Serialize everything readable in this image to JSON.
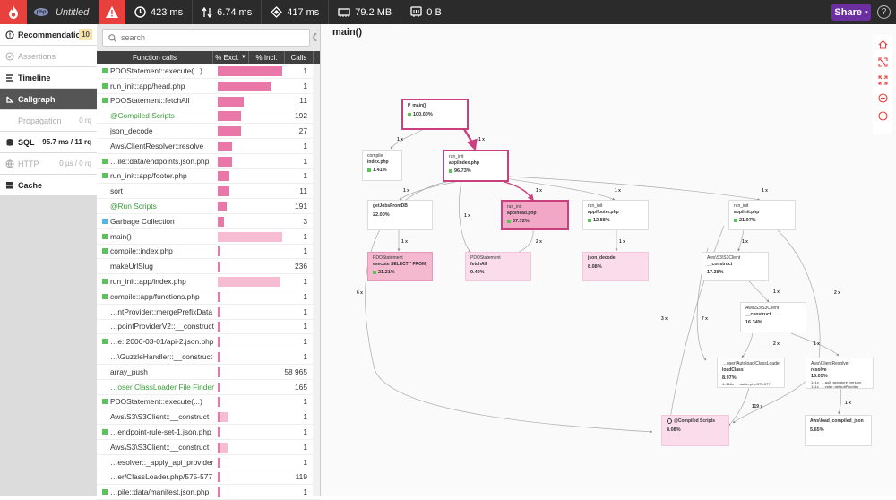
{
  "app": {
    "title": "Untitled",
    "php_badge": "php",
    "share": "Share",
    "help": "?"
  },
  "metrics": [
    {
      "icon": "clock-icon",
      "value": "423 ms"
    },
    {
      "icon": "io-wait-icon",
      "value": "6.74 ms"
    },
    {
      "icon": "cpu-icon",
      "value": "417 ms"
    },
    {
      "icon": "memory-icon",
      "value": "79.2 MB"
    },
    {
      "icon": "network-icon",
      "value": "0 B"
    }
  ],
  "nav": {
    "recommendations": "Recommendations",
    "recommendations_count": "10",
    "assertions": "Assertions",
    "timeline": "Timeline",
    "callgraph": "Callgraph",
    "propagation": "Propagation",
    "propagation_value": "0 rq",
    "sql": "SQL",
    "sql_value": "95.7 ms / 11 rq",
    "http": "HTTP",
    "http_value": "0 µs / 0 rq",
    "cache": "Cache"
  },
  "search": {
    "placeholder": "search"
  },
  "table": {
    "headers": {
      "func": "Function calls",
      "excl": "% Excl.",
      "incl": "% Incl.",
      "calls": "Calls"
    },
    "rows": [
      {
        "name": "PDOStatement::execute(...)",
        "calls": "1",
        "mark": "#5cc25c",
        "green": false,
        "excl": 0.22,
        "incl": 0.22
      },
      {
        "name": "run_init::app/head.php",
        "calls": "1",
        "mark": "#5cc25c",
        "green": false,
        "excl": 0.18,
        "incl": 0.38
      },
      {
        "name": "PDOStatement::fetchAll",
        "calls": "11",
        "mark": "#5cc25c",
        "green": false,
        "excl": 0.09,
        "incl": 0.09
      },
      {
        "name": "@Compiled Scripts",
        "calls": "192",
        "mark": "",
        "green": true,
        "excl": 0.08,
        "incl": 0.08
      },
      {
        "name": "json_decode",
        "calls": "27",
        "mark": "",
        "green": false,
        "excl": 0.08,
        "incl": 0.08
      },
      {
        "name": "Aws\\ClientResolver::resolve",
        "calls": "1",
        "mark": "",
        "green": false,
        "excl": 0.05,
        "incl": 0.15
      },
      {
        "name": "…ile::data/endpoints.json.php",
        "calls": "1",
        "mark": "#5cc25c",
        "green": false,
        "excl": 0.05,
        "incl": 0.05
      },
      {
        "name": "run_init::app/footer.php",
        "calls": "1",
        "mark": "#5cc25c",
        "green": false,
        "excl": 0.04,
        "incl": 0.12
      },
      {
        "name": "sort",
        "calls": "11",
        "mark": "",
        "green": false,
        "excl": 0.04,
        "incl": 0.04
      },
      {
        "name": "@Run Scripts",
        "calls": "191",
        "mark": "",
        "green": true,
        "excl": 0.03,
        "incl": 0.03
      },
      {
        "name": "Garbage Collection",
        "calls": "3",
        "mark": "#4fb8e0",
        "green": false,
        "excl": 0.02,
        "incl": 0.02
      },
      {
        "name": "main()",
        "calls": "1",
        "mark": "#5cc25c",
        "green": false,
        "excl": 0.01,
        "incl": 1.0
      },
      {
        "name": "compile::index.php",
        "calls": "1",
        "mark": "#5cc25c",
        "green": false,
        "excl": 0.01,
        "incl": 0.01
      },
      {
        "name": "makeUrlSlug",
        "calls": "236",
        "mark": "",
        "green": false,
        "excl": 0.01,
        "incl": 0.01
      },
      {
        "name": "run_init::app/index.php",
        "calls": "1",
        "mark": "#5cc25c",
        "green": false,
        "excl": 0.01,
        "incl": 0.97
      },
      {
        "name": "compile::app/functions.php",
        "calls": "1",
        "mark": "#5cc25c",
        "green": false,
        "excl": 0.01,
        "incl": 0.01
      },
      {
        "name": "…ntProvider::mergePrefixData",
        "calls": "1",
        "mark": "",
        "green": false,
        "excl": 0.01,
        "incl": 0.01
      },
      {
        "name": "…pointProviderV2::__construct",
        "calls": "1",
        "mark": "",
        "green": false,
        "excl": 0.01,
        "incl": 0.01
      },
      {
        "name": "…e::2006-03-01/api-2.json.php",
        "calls": "1",
        "mark": "#5cc25c",
        "green": false,
        "excl": 0.01,
        "incl": 0.01
      },
      {
        "name": "…\\GuzzleHandler::__construct",
        "calls": "1",
        "mark": "",
        "green": false,
        "excl": 0.01,
        "incl": 0.01
      },
      {
        "name": "array_push",
        "calls": "58 965",
        "mark": "",
        "green": false,
        "excl": 0.01,
        "incl": 0.01
      },
      {
        "name": "…oser ClassLoader File Finder",
        "calls": "165",
        "mark": "",
        "green": true,
        "excl": 0.01,
        "incl": 0.01
      },
      {
        "name": "PDOStatement::execute(...)",
        "calls": "1",
        "mark": "#5cc25c",
        "green": false,
        "excl": 0.01,
        "incl": 0.01
      },
      {
        "name": "Aws\\S3\\S3Client::__construct",
        "calls": "1",
        "mark": "",
        "green": false,
        "excl": 0.01,
        "incl": 0.16
      },
      {
        "name": "…endpoint-rule-set-1.json.php",
        "calls": "1",
        "mark": "#5cc25c",
        "green": false,
        "excl": 0.01,
        "incl": 0.01
      },
      {
        "name": "Aws\\S3\\S3Client::__construct",
        "calls": "1",
        "mark": "",
        "green": false,
        "excl": 0.01,
        "incl": 0.15
      },
      {
        "name": "…esolver::_apply_api_provider",
        "calls": "1",
        "mark": "",
        "green": false,
        "excl": 0.01,
        "incl": 0.01
      },
      {
        "name": "…er/ClassLoader.php/575-577",
        "calls": "119",
        "mark": "",
        "green": false,
        "excl": 0.01,
        "incl": 0.01
      },
      {
        "name": "…pile::data/manifest.json.php",
        "calls": "1",
        "mark": "#5cc25c",
        "green": false,
        "excl": 0.01,
        "incl": 0.01
      }
    ]
  },
  "graph": {
    "title": "main()",
    "nodes": {
      "main": {
        "name": "main()",
        "pct": "100.00%"
      },
      "compile_index": {
        "l1": "compile",
        "l2": "index.php",
        "pct": "1.41%"
      },
      "run_init_index": {
        "l1": "run_init",
        "l2": "app/index.php",
        "pct": "96.73%"
      },
      "getjob": {
        "l1": "getJobsFromDB",
        "pct": "22.00%"
      },
      "pdo_exec": {
        "l1": "PDOStatement",
        "l2": "execute SELECT * FROM jobs …",
        "pct": "21.21%"
      },
      "run_init_head": {
        "l1": "run_init",
        "l2": "app/head.php",
        "pct": "37.72%"
      },
      "pdo_fetch": {
        "l1": "PDOStatement",
        "l2": "fetchAll",
        "pct": "9.40%"
      },
      "run_init_footer": {
        "l1": "run_init",
        "l2": "app/footer.php",
        "pct": "12.88%"
      },
      "json_decode": {
        "l1": "json_decode",
        "pct": "8.08%"
      },
      "run_init_init": {
        "l1": "run_init",
        "l2": "app/init.php",
        "pct": "21.97%"
      },
      "s3client_a": {
        "l1": "Aws\\S3\\S3Client",
        "l2": "__construct",
        "pct": "17.38%"
      },
      "s3client_b": {
        "l1": "Aws\\S3\\S3Client",
        "l2": "__construct",
        "pct": "16.34%"
      },
      "autoload": {
        "l1": "…oser\\Autoload\\ClassLoader",
        "l2": "loadClass",
        "pct": "8.97%",
        "x1": "1×118x",
        "x2": "…oader.php/575-577"
      },
      "clientresolver": {
        "l1": "Aws\\ClientResolver",
        "l2": "resolve",
        "pct": "15.05%",
        "x1": "1×1x",
        "x2": "…ault_signature_version",
        "x3": "1×1x",
        "x4": "…vider::defaultProvider"
      },
      "compiled": {
        "l1": "@Compiled Scripts",
        "pct": "8.08%"
      },
      "awsload": {
        "l1": "Aws\\load_compiled_json",
        "pct": "5.65%"
      }
    },
    "edges": {
      "e1": "1 x",
      "e2": "1 x",
      "e3": "1 x",
      "e4": "1 x",
      "e5": "1 x",
      "e6": "1 x",
      "e7": "1 x",
      "e8": "1 x",
      "e9": "2 x",
      "e10": "1 x",
      "e11": "1 x",
      "e12": "1 x",
      "e13": "6 x",
      "e14": "3 x",
      "e15": "7 x",
      "e16": "2 x",
      "e17": "2 x",
      "e18": "1 x",
      "e19": "119 x",
      "e20": "1 x"
    }
  }
}
